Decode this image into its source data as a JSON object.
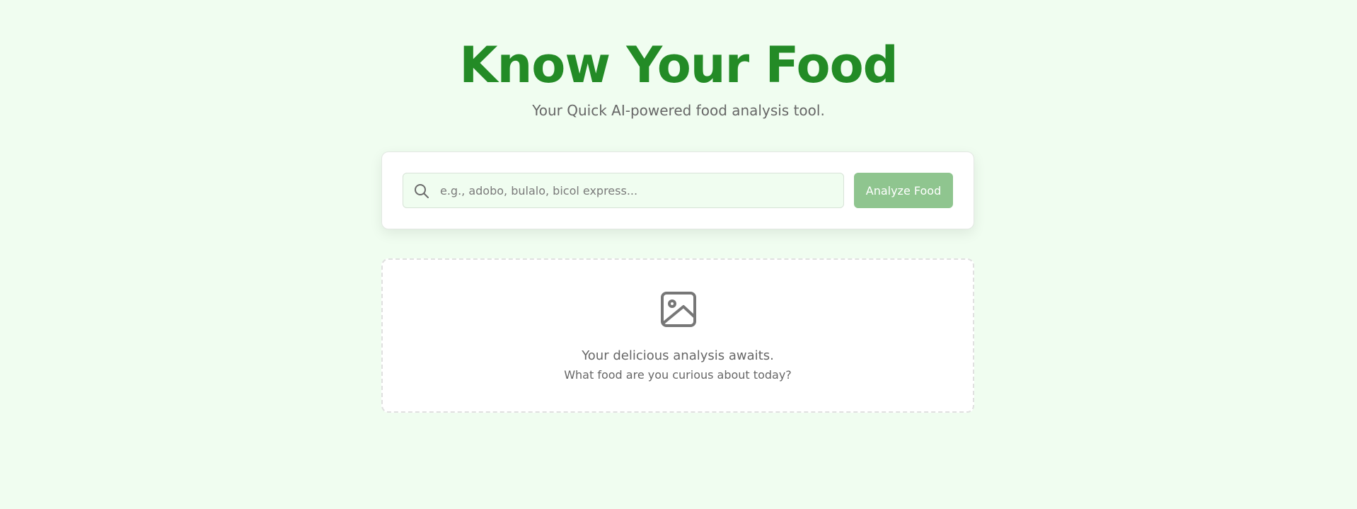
{
  "header": {
    "title": "Know Your Food",
    "subtitle": "Your Quick AI-powered food analysis tool."
  },
  "search": {
    "icon": "search-icon",
    "value": "",
    "placeholder": "e.g., adobo, bulalo, bicol express...",
    "button_label": "Analyze Food"
  },
  "empty_state": {
    "icon": "image-icon",
    "title": "Your delicious analysis awaits.",
    "subtitle": "What food are you curious about today?"
  },
  "colors": {
    "background": "#f0fdf0",
    "title": "#238b26",
    "button": "#8fc58f",
    "muted_text": "#666666"
  }
}
